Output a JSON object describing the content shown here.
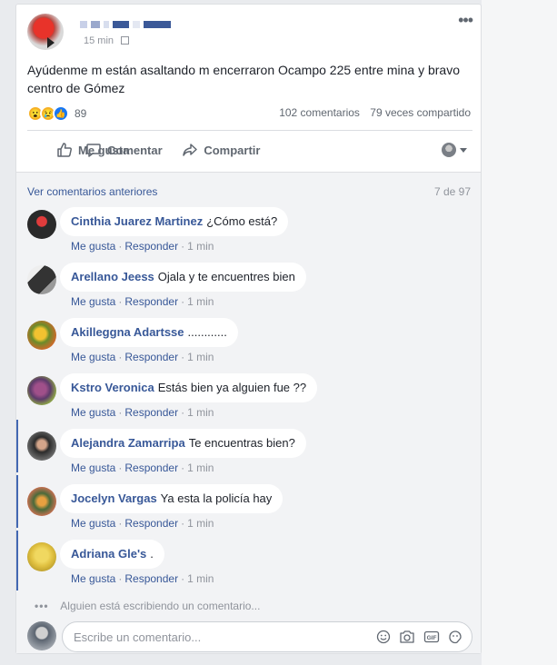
{
  "post": {
    "time": "15 min",
    "text": "Ayúdenme m están asaltando m encerraron Ocampo 225 entre mina y bravo centro de Gómez",
    "reaction_count": "89",
    "comments_count": "102 comentarios",
    "shares_count": "79 veces compartido"
  },
  "actions": {
    "like": "Me gusta",
    "comment": "Comentar",
    "share": "Compartir"
  },
  "comments_section": {
    "prev_link": "Ver comentarios anteriores",
    "pager": "7 de 97",
    "items": [
      {
        "author": "Cinthia Juarez Martinez",
        "text": "¿Cómo está?",
        "like": "Me gusta",
        "reply": "Responder",
        "time": "1 min"
      },
      {
        "author": "Arellano Jeess",
        "text": "Ojala y te encuentres bien",
        "like": "Me gusta",
        "reply": "Responder",
        "time": "1 min"
      },
      {
        "author": "Akilleggna Adartsse",
        "text": "............",
        "like": "Me gusta",
        "reply": "Responder",
        "time": "1 min"
      },
      {
        "author": "Kstro Veronica",
        "text": "Estás bien ya alguien fue ??",
        "like": "Me gusta",
        "reply": "Responder",
        "time": "1 min"
      },
      {
        "author": "Alejandra Zamarripa",
        "text": "Te encuentras bien?",
        "like": "Me gusta",
        "reply": "Responder",
        "time": "1 min"
      },
      {
        "author": "Jocelyn Vargas",
        "text": "Ya esta la policía hay",
        "like": "Me gusta",
        "reply": "Responder",
        "time": "1 min"
      },
      {
        "author": "Adriana Gle's",
        "text": ".",
        "like": "Me gusta",
        "reply": "Responder",
        "time": "1 min"
      }
    ],
    "typing": "Alguien está escribiendo un comentario...",
    "composer_placeholder": "Escribe un comentario..."
  },
  "colors": {
    "link": "#385898",
    "like_blue": "#1877f2",
    "accent_bar": "#4267b2"
  }
}
